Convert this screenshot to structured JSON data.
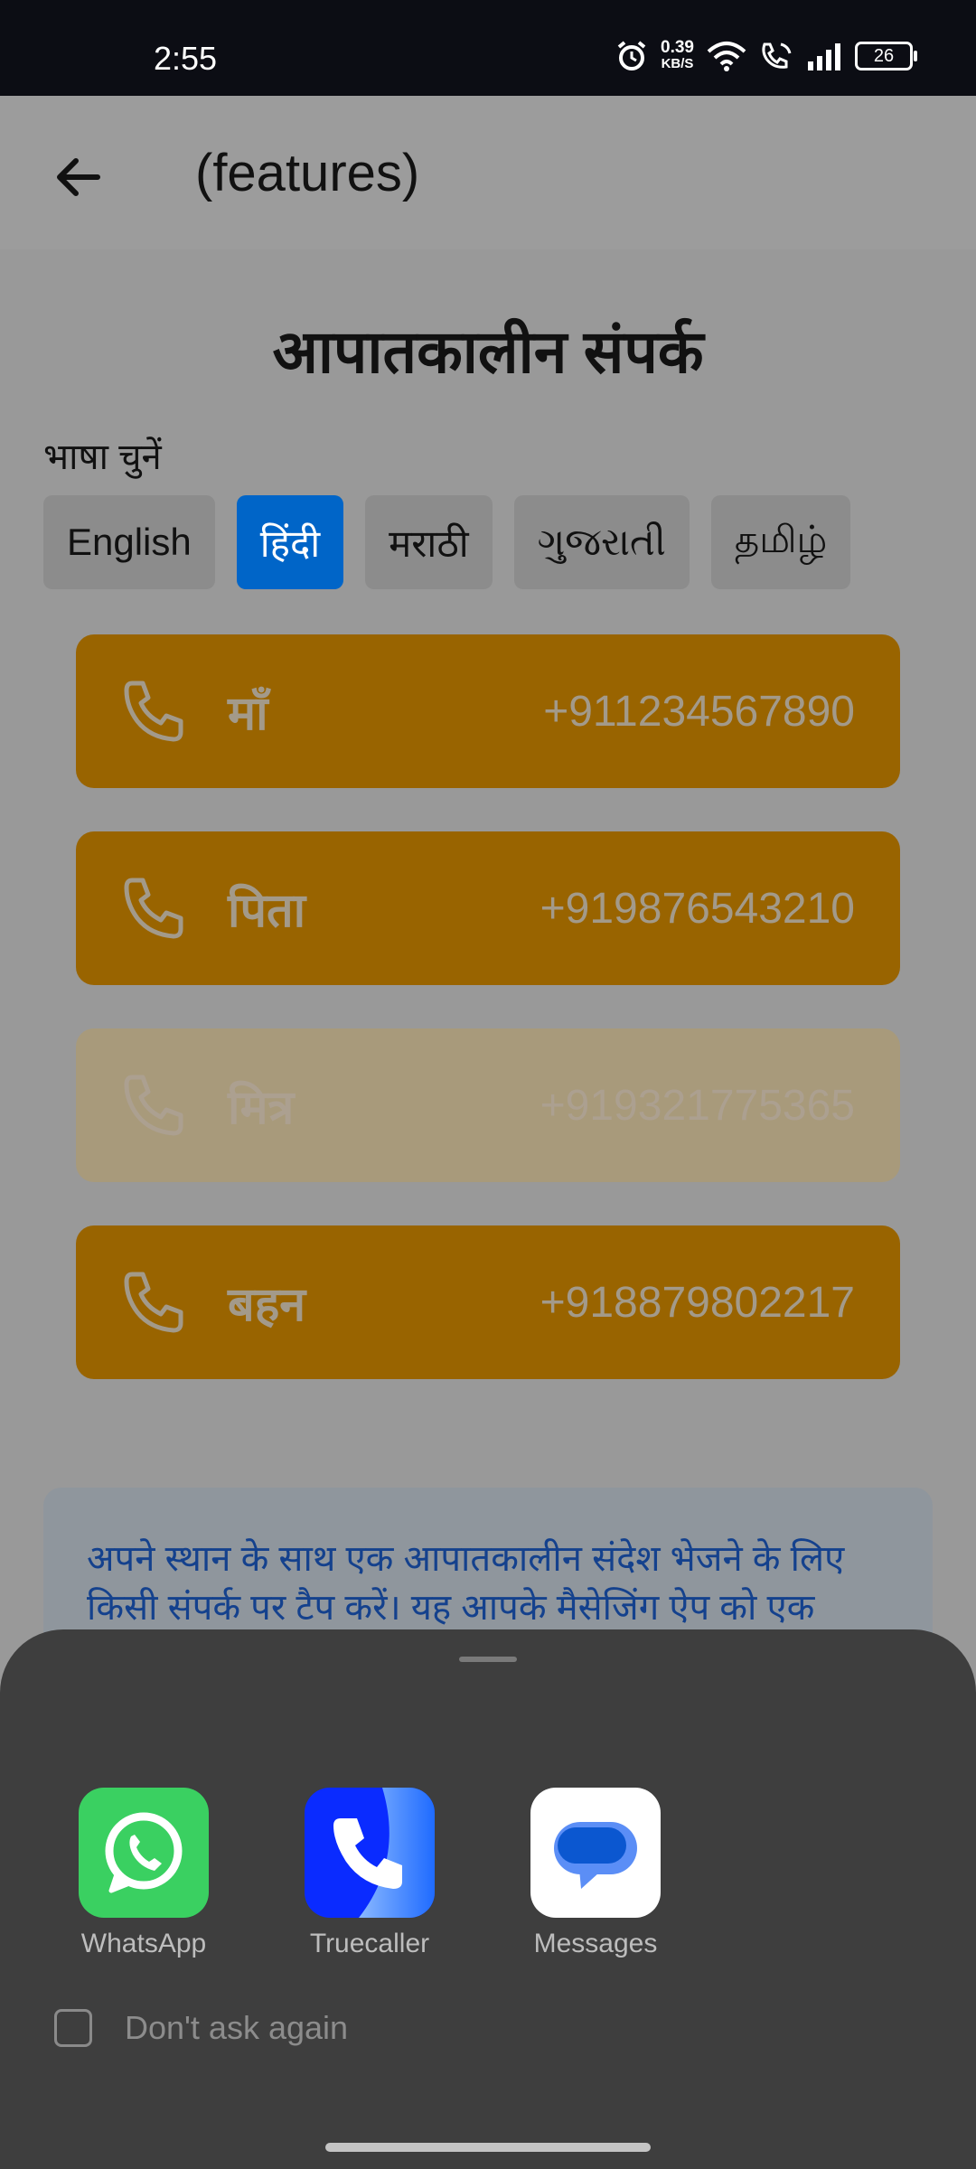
{
  "status_bar": {
    "time": "2:55",
    "speed_value": "0.39",
    "speed_unit": "KB/S",
    "battery": "26"
  },
  "app_bar": {
    "title": "(features)",
    "back_icon": "arrow-left-icon"
  },
  "page": {
    "heading": "आपातकालीन संपर्क",
    "language_label": "भाषा चुनें",
    "languages": [
      {
        "label": "English",
        "active": false
      },
      {
        "label": "हिंदी",
        "active": true
      },
      {
        "label": "मराठी",
        "active": false
      },
      {
        "label": "ગુજરાતી",
        "active": false
      },
      {
        "label": "தமிழ்",
        "active": false
      }
    ],
    "contacts": [
      {
        "name": "माँ",
        "number": "+911234567890"
      },
      {
        "name": "पिता",
        "number": "+919876543210"
      },
      {
        "name": "मित्र",
        "number": "+919321775365"
      },
      {
        "name": "बहन",
        "number": "+918879802217"
      }
    ],
    "info_text": "अपने स्थान के साथ एक आपातकालीन संदेश भेजने के लिए किसी संपर्क पर टैप करें। यह आपके मैसेजिंग ऐप को एक"
  },
  "share_sheet": {
    "apps": [
      {
        "label": "WhatsApp",
        "icon": "whatsapp-icon"
      },
      {
        "label": "Truecaller",
        "icon": "truecaller-icon"
      },
      {
        "label": "Messages",
        "icon": "messages-icon"
      }
    ],
    "dont_ask_label": "Don't ask again"
  },
  "colors": {
    "accent_orange": "#996400",
    "selected_blue": "#0065c8",
    "info_text_blue": "#14418d"
  }
}
